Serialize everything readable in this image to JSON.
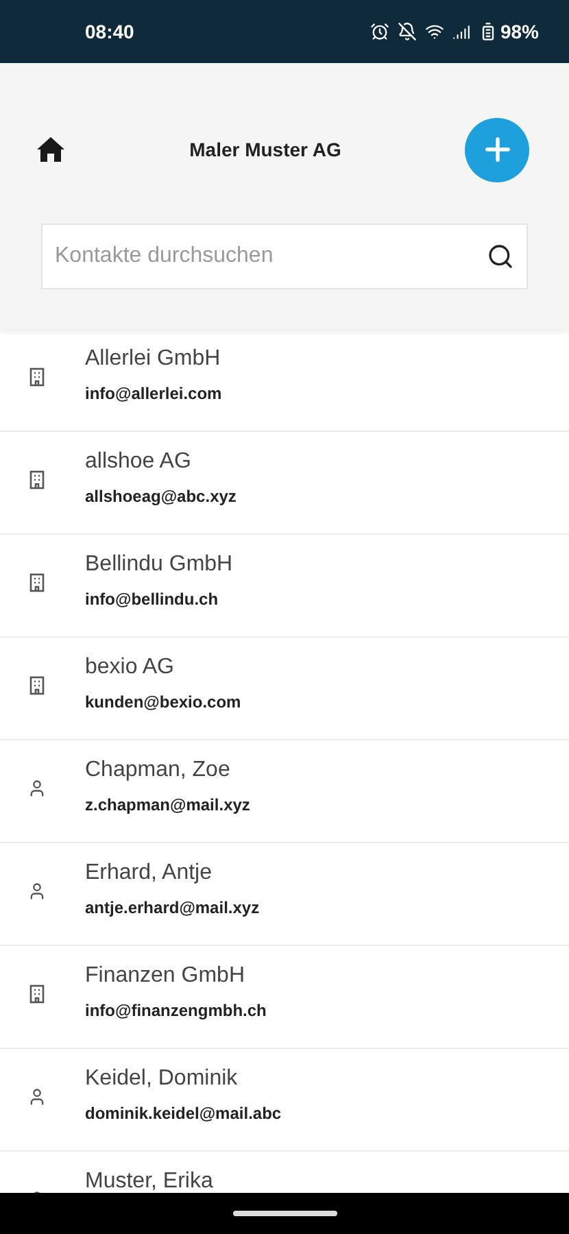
{
  "status_bar": {
    "time": "08:40",
    "battery": "98%"
  },
  "header": {
    "title": "Maler Muster AG"
  },
  "search": {
    "placeholder": "Kontakte durchsuchen"
  },
  "contacts": [
    {
      "kind": "company",
      "name": "Allerlei GmbH",
      "email": "info@allerlei.com"
    },
    {
      "kind": "company",
      "name": "allshoe AG",
      "email": "allshoeag@abc.xyz"
    },
    {
      "kind": "company",
      "name": "Bellindu GmbH",
      "email": "info@bellindu.ch"
    },
    {
      "kind": "company",
      "name": "bexio AG",
      "email": "kunden@bexio.com"
    },
    {
      "kind": "person",
      "name": "Chapman, Zoe",
      "email": "z.chapman@mail.xyz"
    },
    {
      "kind": "person",
      "name": "Erhard, Antje",
      "email": "antje.erhard@mail.xyz"
    },
    {
      "kind": "company",
      "name": "Finanzen GmbH",
      "email": "info@finanzengmbh.ch"
    },
    {
      "kind": "person",
      "name": "Keidel, Dominik",
      "email": "dominik.keidel@mail.abc"
    },
    {
      "kind": "person",
      "name": "Muster, Erika"
    }
  ]
}
